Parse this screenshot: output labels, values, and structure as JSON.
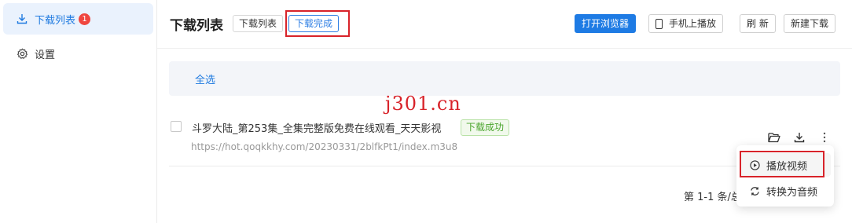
{
  "sidebar": {
    "items": [
      {
        "label": "下载列表",
        "icon": "download-icon",
        "badge": "1",
        "active": true
      },
      {
        "label": "设置",
        "icon": "gear-icon",
        "active": false
      }
    ]
  },
  "header": {
    "title": "下载列表",
    "tabs": [
      {
        "label": "下载列表",
        "active": false
      },
      {
        "label": "下载完成",
        "active": true
      }
    ],
    "buttons": {
      "open_browser": "打开浏览器",
      "phone_play": "手机上播放",
      "refresh": "刷 新",
      "new_download": "新建下载"
    }
  },
  "select_all": "全选",
  "watermark": "j301.cn",
  "items": [
    {
      "title": "斗罗大陆_第253集_全集完整版免费在线观看_天天影视",
      "status": "下载成功",
      "url": "https://hot.qoqkkhy.com/20230331/2blfkPt1/index.m3u8"
    }
  ],
  "pagination": "第 1-1 条/总",
  "menu": {
    "play_video": "播放视频",
    "convert_audio": "转换为音频"
  },
  "colors": {
    "accent": "#1e7be4",
    "success": "#4aa52d",
    "highlight_box": "#d8232a",
    "badge": "#f0463f"
  }
}
